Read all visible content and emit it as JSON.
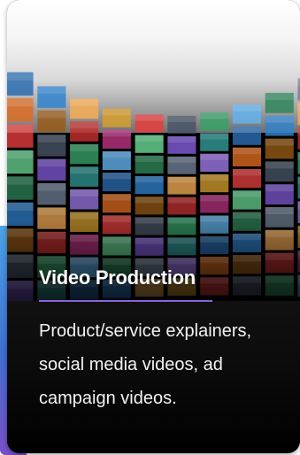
{
  "card": {
    "title": "Video Production",
    "description": "Product/service explainers, social media videos, ad campaign videos."
  },
  "colors": {
    "accent_rule": "#8b62d9",
    "side_accent_top": "#4aa3e8",
    "side_accent_bottom": "#7a4fc9",
    "title_text": "#ffffff"
  },
  "image": {
    "subject": "curved wall of many TV screens"
  }
}
